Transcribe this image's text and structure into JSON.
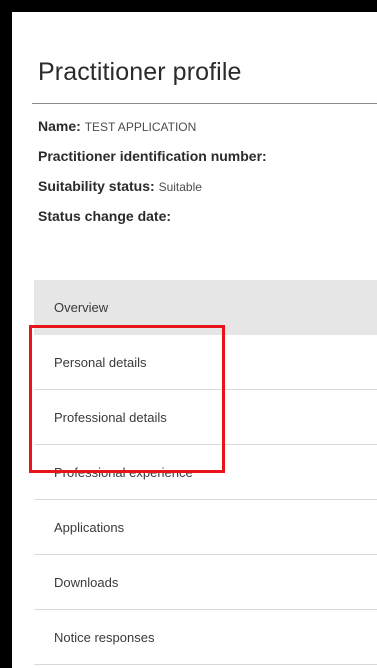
{
  "page": {
    "title": "Practitioner profile"
  },
  "profile": {
    "name_label": "Name:",
    "name_value": "TEST APPLICATION",
    "pin_label": "Practitioner identification number:",
    "pin_value": "",
    "suitability_label": "Suitability status:",
    "suitability_value": "Suitable",
    "status_date_label": "Status change date:",
    "status_date_value": ""
  },
  "nav": {
    "items": [
      {
        "label": "Overview",
        "active": true
      },
      {
        "label": "Personal details"
      },
      {
        "label": "Professional details"
      },
      {
        "label": "Professional experience"
      },
      {
        "label": "Applications"
      },
      {
        "label": "Downloads"
      },
      {
        "label": "Notice responses"
      }
    ]
  },
  "highlight": {
    "color": "#e8141b"
  }
}
